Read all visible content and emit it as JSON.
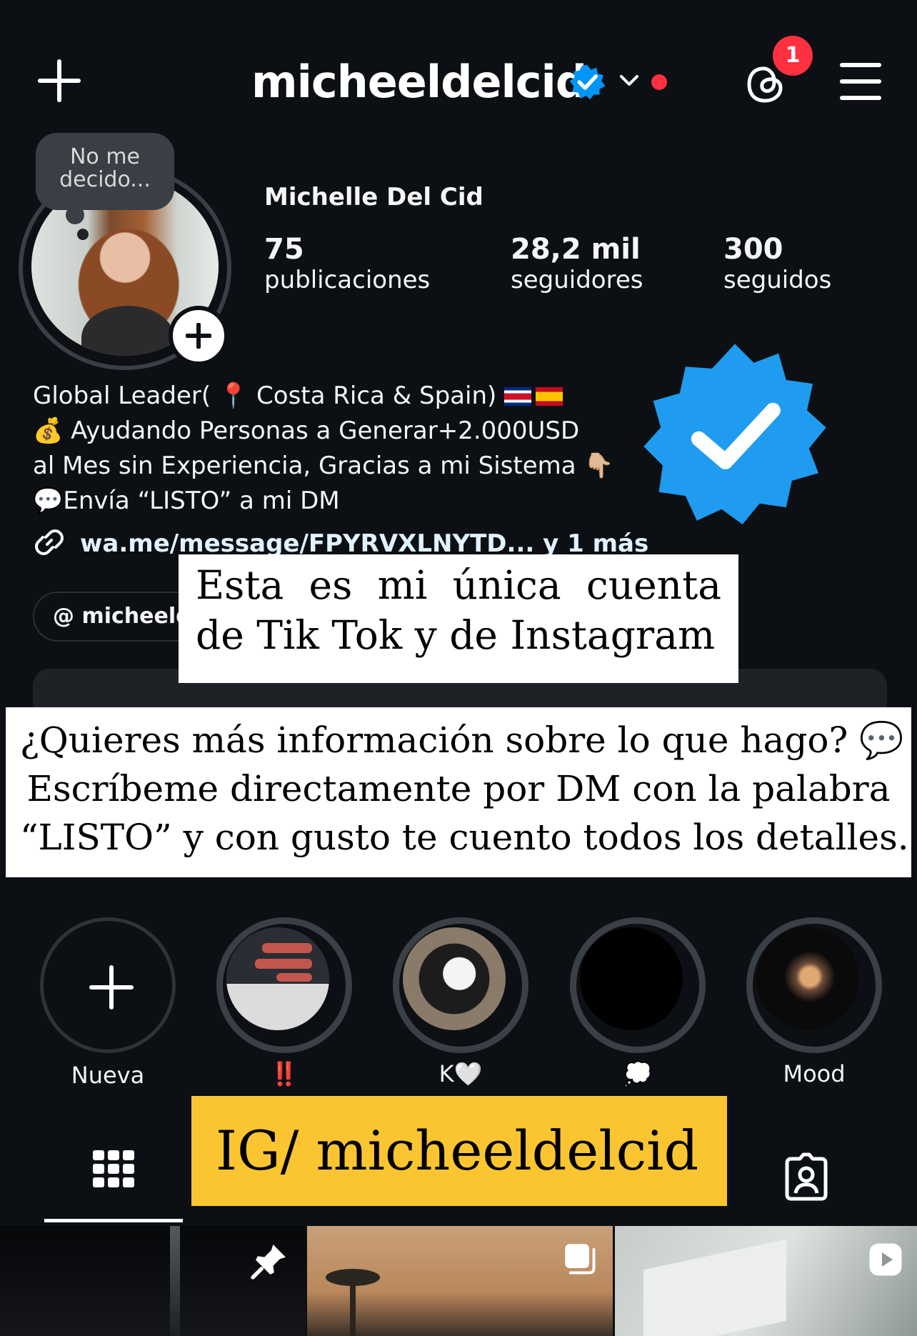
{
  "header": {
    "username": "micheeldelcid",
    "notification_count": "1"
  },
  "profile": {
    "note": "No me decido...",
    "full_name": "Michelle Del Cid",
    "stats": [
      {
        "value": "75",
        "label": "publicaciones"
      },
      {
        "value": "28,2 mil",
        "label": "seguidores"
      },
      {
        "value": "300",
        "label": "seguidos"
      }
    ],
    "bio": {
      "line1": "Global Leader( 📍 Costa Rica & Spain)",
      "line2": "💰 Ayudando Personas a Generar+2.000USD",
      "line3": "al Mes sin Experiencia, Gracias a mi Sistema 👇🏼",
      "line4": "💬Envía “LISTO” a mi DM"
    },
    "link": "wa.me/message/FPYRVXLNYTD...  y 1 más",
    "threads_handle": "micheeldelcid"
  },
  "overlays": {
    "top_caption": "Esta es mi única cuenta de Tik Tok y de Instagram",
    "middle_line1": "¿Quieres más información sobre lo que hago? 💬",
    "middle_line2": "Escríbeme directamente por DM con la palabra",
    "middle_line3": "“LISTO” y con gusto te cuento todos los detalles.",
    "bottom_caption": "IG/ micheeldelcid"
  },
  "highlights": [
    {
      "label": "Nueva",
      "icon": "plus-icon"
    },
    {
      "label": "‼️",
      "icon": "chat-screenshot"
    },
    {
      "label": "K🤍",
      "icon": "dog-photo"
    },
    {
      "label": "💭",
      "icon": "dark-photo"
    },
    {
      "label": "Mood",
      "icon": "candle-photo"
    }
  ],
  "tabs": [
    {
      "name": "grid",
      "icon": "grid-icon",
      "active": true
    },
    {
      "name": "tagged",
      "icon": "tagged-person-icon",
      "active": false
    }
  ],
  "posts": [
    {
      "icon": "pin-icon"
    },
    {
      "icon": "carousel-icon"
    },
    {
      "icon": "reel-icon"
    }
  ],
  "colors": {
    "background": "#0c1014",
    "verified_blue": "#0095f6",
    "notification_red": "#ff3040",
    "caption_yellow": "#fbc531"
  }
}
